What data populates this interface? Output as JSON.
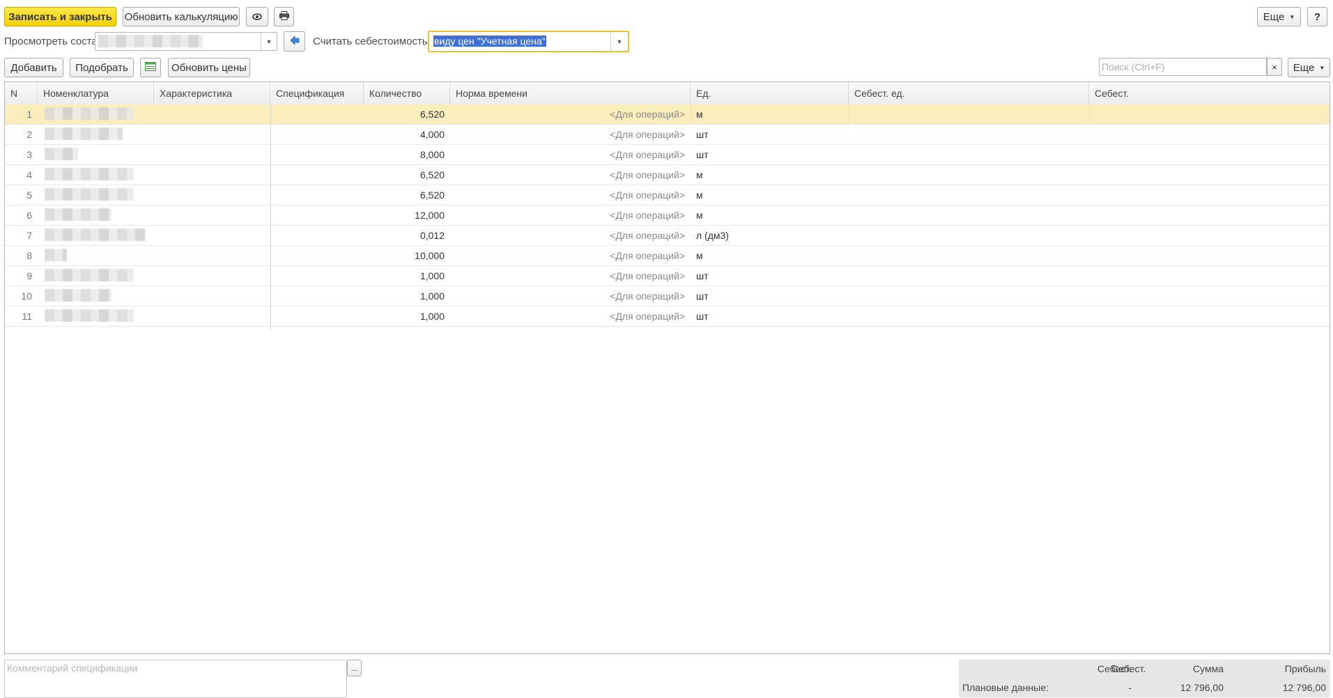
{
  "toolbar": {
    "save_close_label": "Записать и закрыть",
    "refresh_calc_label": "Обновить калькуляцию",
    "more_label": "Еще",
    "help_label": "?"
  },
  "filter": {
    "view_label": "Просмотреть состав:",
    "cost_label": "Считать себестоимость по:",
    "cost_value": "виду цен \"Учетная цена\""
  },
  "table_toolbar": {
    "add_label": "Добавить",
    "pick_label": "Подобрать",
    "update_prices_label": "Обновить цены",
    "search_placeholder": "Поиск (Ctrl+F)",
    "clear_label": "×",
    "more_label": "Еще"
  },
  "table": {
    "columns": {
      "n": "N",
      "item": "Номенклатура",
      "characteristic": "Характеристика",
      "specification": "Спецификация",
      "quantity": "Количество",
      "time_norm": "Норма времени",
      "unit": "Ед.",
      "unit_cost": "Себест. ед.",
      "cost": "Себест."
    },
    "rows": [
      {
        "n": "1",
        "quantity": "6,520",
        "time_norm": "<Для операций>",
        "unit": "м"
      },
      {
        "n": "2",
        "quantity": "4,000",
        "time_norm": "<Для операций>",
        "unit": "шт"
      },
      {
        "n": "3",
        "quantity": "8,000",
        "time_norm": "<Для операций>",
        "unit": "шт"
      },
      {
        "n": "4",
        "quantity": "6,520",
        "time_norm": "<Для операций>",
        "unit": "м"
      },
      {
        "n": "5",
        "quantity": "6,520",
        "time_norm": "<Для операций>",
        "unit": "м"
      },
      {
        "n": "6",
        "quantity": "12,000",
        "time_norm": "<Для операций>",
        "unit": "м"
      },
      {
        "n": "7",
        "quantity": "0,012",
        "time_norm": "<Для операций>",
        "unit": "л (дм3)"
      },
      {
        "n": "8",
        "quantity": "10,000",
        "time_norm": "<Для операций>",
        "unit": "м"
      },
      {
        "n": "9",
        "quantity": "1,000",
        "time_norm": "<Для операций>",
        "unit": "шт"
      },
      {
        "n": "10",
        "quantity": "1,000",
        "time_norm": "<Для операций>",
        "unit": "шт"
      },
      {
        "n": "11",
        "quantity": "1,000",
        "time_norm": "<Для операций>",
        "unit": "шт"
      }
    ]
  },
  "comment": {
    "placeholder": "Комментарий спецификации",
    "button_label": "..."
  },
  "summary": {
    "col_cost": "Себест.",
    "col_sum": "Сумма",
    "col_profit": "Прибыль",
    "row_label": "Плановые данные:",
    "cost": "-",
    "sum": "12 796,00",
    "profit": "12 796,00"
  },
  "colors": {
    "accent_yellow": "#f5d100",
    "selected_row": "#fbeebc",
    "focus_border": "#f2c12e",
    "selection_blue": "#3d6fd6"
  }
}
